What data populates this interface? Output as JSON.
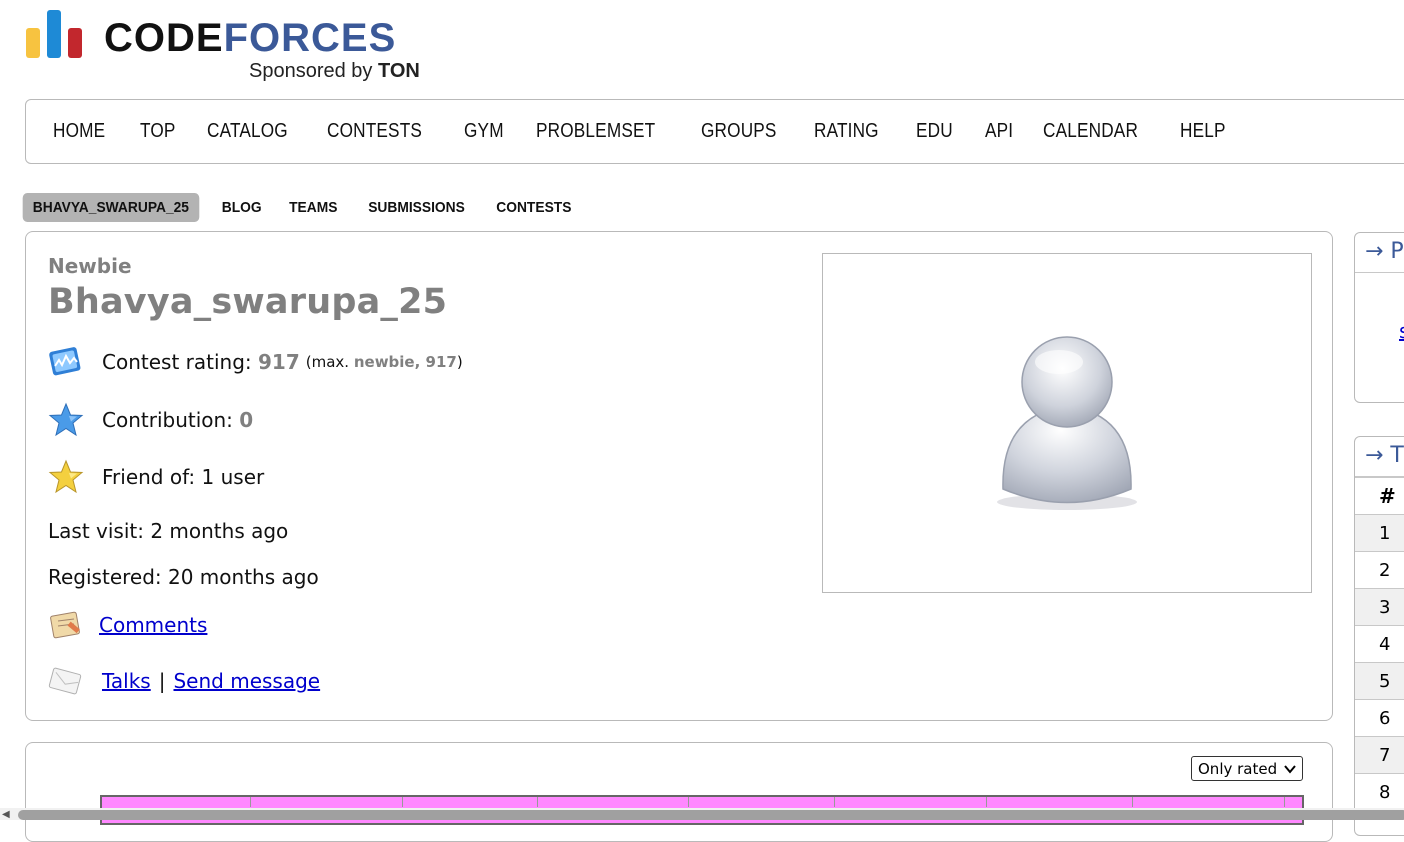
{
  "logo": {
    "code": "CODE",
    "forces": "FORCES",
    "sponsored_by": "Sponsored by",
    "sponsor": "TON",
    "colors": {
      "yellow": "#f7c340",
      "blue": "#1e8ad6",
      "red": "#c2272d"
    }
  },
  "main_menu": [
    "HOME",
    "TOP",
    "CATALOG",
    "CONTESTS",
    "GYM",
    "PROBLEMSET",
    "GROUPS",
    "RATING",
    "EDU",
    "API",
    "CALENDAR",
    "HELP"
  ],
  "second_menu": {
    "active": "BHAVYA_SWARUPA_25",
    "items": [
      "BLOG",
      "TEAMS",
      "SUBMISSIONS",
      "CONTESTS"
    ]
  },
  "user": {
    "rank": "Newbie",
    "handle": "Bhavya_swarupa_25",
    "contest_rating_label": "Contest rating:",
    "contest_rating": "917",
    "max_prefix": "(max.",
    "max_value": "newbie, 917",
    "max_suffix": ")",
    "contribution_label": "Contribution:",
    "contribution": "0",
    "friend_of": "Friend of: 1 user",
    "last_visit": "Last visit: 2 months ago",
    "registered": "Registered: 20 months ago",
    "comments_link": "Comments",
    "talks_link": "Talks",
    "sep": "|",
    "send_message_link": "Send message",
    "rank_color": "#808080",
    "link_color": "#0000cc"
  },
  "graph": {
    "filter_selected": "Only rated",
    "chevron": "⌄"
  },
  "sidebar": {
    "box1_caption": "→ P",
    "box1_fragment": "s",
    "box2_caption": "→ T",
    "table_header": "#",
    "rows": [
      "1",
      "2",
      "3",
      "4",
      "5",
      "6",
      "7",
      "8"
    ]
  }
}
